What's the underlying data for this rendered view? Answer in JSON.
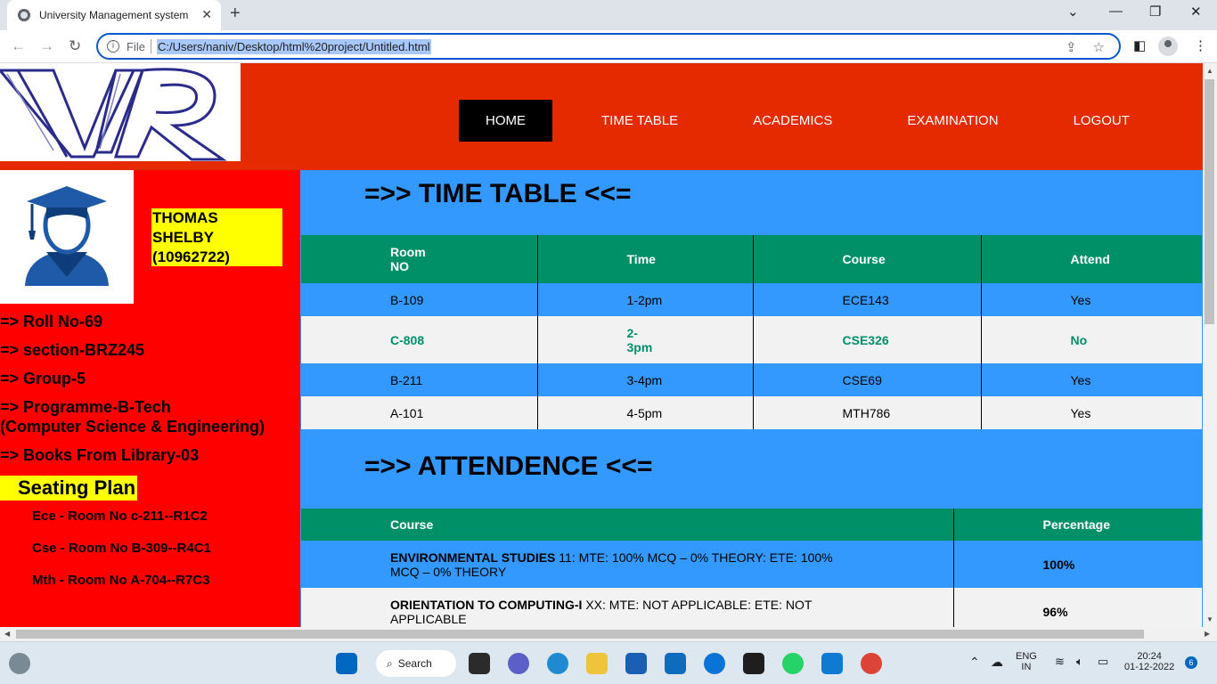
{
  "browser": {
    "tab_title": "University Management system",
    "file_label": "File",
    "url": "C:/Users/naniv/Desktop/html%20project/Untitled.html"
  },
  "nav": {
    "items": [
      {
        "label": "HOME"
      },
      {
        "label": "TIME TABLE"
      },
      {
        "label": "ACADEMICS"
      },
      {
        "label": "EXAMINATION"
      },
      {
        "label": "LOGOUT"
      }
    ]
  },
  "student": {
    "name_line1": "THOMAS",
    "name_line2": "SHELBY",
    "id": "(10962722)",
    "roll": "=> Roll No-69",
    "section": "=> section-BRZ245",
    "group": "=> Group-5",
    "programme_line1": "=> Programme-B-Tech",
    "programme_line2": "(Computer Science & Engineering)",
    "books": "=> Books From Library-03"
  },
  "seating": {
    "title": "Seating Plan",
    "items": [
      "Ece - Room No c-211--R1C2",
      "Cse - Room No B-309--R4C1",
      "Mth - Room No A-704--R7C3"
    ]
  },
  "timetable": {
    "heading": "=>> TIME TABLE <<=",
    "headers": [
      "Room NO",
      "Time",
      "Course",
      "Attend"
    ],
    "rows": [
      {
        "room": "B-109",
        "time": "1-2pm",
        "course": "ECE143",
        "attend": "Yes"
      },
      {
        "room": "C-808",
        "time": "2-3pm",
        "course": "CSE326",
        "attend": "No"
      },
      {
        "room": "B-211",
        "time": "3-4pm",
        "course": "CSE69",
        "attend": "Yes"
      },
      {
        "room": "A-101",
        "time": "4-5pm",
        "course": "MTH786",
        "attend": "Yes"
      }
    ]
  },
  "attendance": {
    "heading": "=>> ATTENDENCE <<=",
    "headers": [
      "Course",
      "Percentage"
    ],
    "rows": [
      {
        "course_name": "ENVIRONMENTAL STUDIES",
        "details": "11: MTE: 100% MCQ – 0% THEORY: ETE: 100% MCQ – 0% THEORY",
        "percentage": "100%"
      },
      {
        "course_name": "ORIENTATION TO COMPUTING-I",
        "details": "XX: MTE: NOT APPLICABLE: ETE: NOT APPLICABLE",
        "percentage": "96%"
      }
    ]
  },
  "taskbar": {
    "search_label": "Search",
    "lang_line1": "ENG",
    "lang_line2": "IN",
    "time": "20:24",
    "date": "01-12-2022",
    "notifications": "6"
  }
}
